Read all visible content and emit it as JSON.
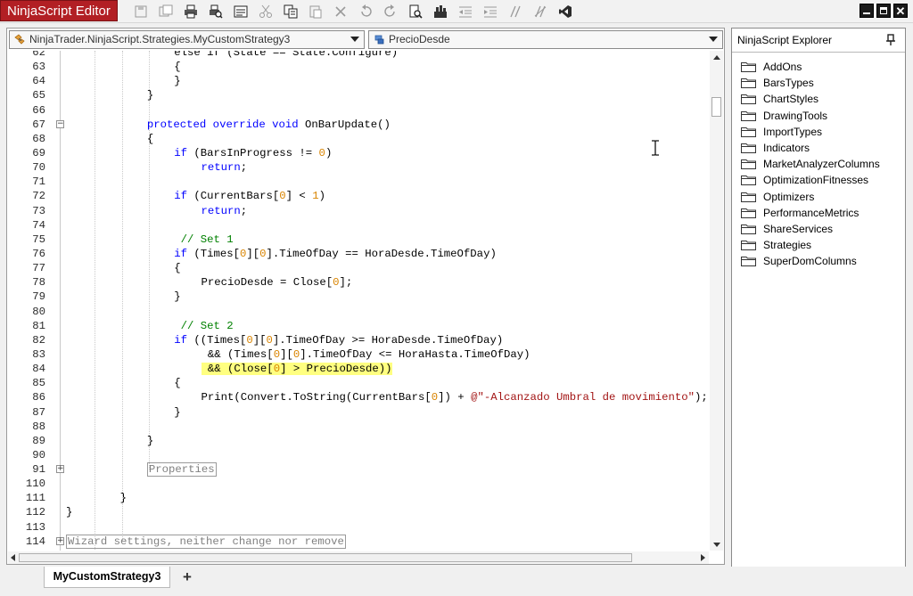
{
  "window": {
    "title": "NinjaScript Editor"
  },
  "toolbar": {
    "icons": [
      "save-icon",
      "save-all-icon",
      "print-icon",
      "print-preview-icon",
      "properties-icon",
      "cut-icon",
      "copy-icon",
      "paste-icon",
      "delete-icon",
      "undo-icon",
      "redo-icon",
      "find-icon",
      "compile-icon",
      "outdent-icon",
      "indent-icon",
      "comment-icon",
      "uncomment-icon",
      "visual-studio-icon"
    ]
  },
  "editor": {
    "class_dropdown": "NinjaTrader.NinjaScript.Strategies.MyCustomStrategy3",
    "member_dropdown": "PrecioDesde",
    "lines": [
      {
        "n": "62",
        "fold": "",
        "indent": 4,
        "seg": [
          {
            "t": "else if (State == State.Configure)",
            "c": ""
          }
        ]
      },
      {
        "n": "63",
        "fold": "",
        "indent": 4,
        "seg": [
          {
            "t": "{",
            "c": ""
          }
        ]
      },
      {
        "n": "64",
        "fold": "",
        "indent": 4,
        "seg": [
          {
            "t": "}",
            "c": ""
          }
        ]
      },
      {
        "n": "65",
        "fold": "",
        "indent": 3,
        "seg": [
          {
            "t": "}",
            "c": ""
          }
        ]
      },
      {
        "n": "66",
        "fold": "",
        "indent": 0,
        "seg": []
      },
      {
        "n": "67",
        "fold": "minus",
        "indent": 3,
        "seg": [
          {
            "t": "protected override void",
            "c": "kw"
          },
          {
            "t": " OnBarUpdate()",
            "c": ""
          }
        ]
      },
      {
        "n": "68",
        "fold": "",
        "indent": 3,
        "seg": [
          {
            "t": "{",
            "c": ""
          }
        ]
      },
      {
        "n": "69",
        "fold": "",
        "indent": 4,
        "seg": [
          {
            "t": "if",
            "c": "kw"
          },
          {
            "t": " (BarsInProgress != ",
            "c": ""
          },
          {
            "t": "0",
            "c": "num"
          },
          {
            "t": ")",
            "c": ""
          }
        ]
      },
      {
        "n": "70",
        "fold": "",
        "indent": 5,
        "seg": [
          {
            "t": "return",
            "c": "kw"
          },
          {
            "t": ";",
            "c": ""
          }
        ]
      },
      {
        "n": "71",
        "fold": "",
        "indent": 0,
        "seg": []
      },
      {
        "n": "72",
        "fold": "",
        "indent": 4,
        "seg": [
          {
            "t": "if",
            "c": "kw"
          },
          {
            "t": " (CurrentBars[",
            "c": ""
          },
          {
            "t": "0",
            "c": "num"
          },
          {
            "t": "] < ",
            "c": ""
          },
          {
            "t": "1",
            "c": "num"
          },
          {
            "t": ")",
            "c": ""
          }
        ]
      },
      {
        "n": "73",
        "fold": "",
        "indent": 5,
        "seg": [
          {
            "t": "return",
            "c": "kw"
          },
          {
            "t": ";",
            "c": ""
          }
        ]
      },
      {
        "n": "74",
        "fold": "",
        "indent": 0,
        "seg": []
      },
      {
        "n": "75",
        "fold": "",
        "indent": 4,
        "seg": [
          {
            "t": " // Set 1",
            "c": "cm"
          }
        ]
      },
      {
        "n": "76",
        "fold": "",
        "indent": 4,
        "seg": [
          {
            "t": "if",
            "c": "kw"
          },
          {
            "t": " (Times[",
            "c": ""
          },
          {
            "t": "0",
            "c": "num"
          },
          {
            "t": "][",
            "c": ""
          },
          {
            "t": "0",
            "c": "num"
          },
          {
            "t": "].TimeOfDay == HoraDesde.TimeOfDay)",
            "c": ""
          }
        ]
      },
      {
        "n": "77",
        "fold": "",
        "indent": 4,
        "seg": [
          {
            "t": "{",
            "c": ""
          }
        ]
      },
      {
        "n": "78",
        "fold": "",
        "indent": 5,
        "seg": [
          {
            "t": "PrecioDesde = Close[",
            "c": ""
          },
          {
            "t": "0",
            "c": "num"
          },
          {
            "t": "];",
            "c": ""
          }
        ]
      },
      {
        "n": "79",
        "fold": "",
        "indent": 4,
        "seg": [
          {
            "t": "}",
            "c": ""
          }
        ]
      },
      {
        "n": "80",
        "fold": "",
        "indent": 0,
        "seg": []
      },
      {
        "n": "81",
        "fold": "",
        "indent": 4,
        "seg": [
          {
            "t": " // Set 2",
            "c": "cm"
          }
        ]
      },
      {
        "n": "82",
        "fold": "",
        "indent": 4,
        "seg": [
          {
            "t": "if",
            "c": "kw"
          },
          {
            "t": " ((Times[",
            "c": ""
          },
          {
            "t": "0",
            "c": "num"
          },
          {
            "t": "][",
            "c": ""
          },
          {
            "t": "0",
            "c": "num"
          },
          {
            "t": "].TimeOfDay >= HoraDesde.TimeOfDay)",
            "c": ""
          }
        ]
      },
      {
        "n": "83",
        "fold": "",
        "indent": 5,
        "seg": [
          {
            "t": " && (Times[",
            "c": ""
          },
          {
            "t": "0",
            "c": "num"
          },
          {
            "t": "][",
            "c": ""
          },
          {
            "t": "0",
            "c": "num"
          },
          {
            "t": "].TimeOfDay <= HoraHasta.TimeOfDay)",
            "c": ""
          }
        ]
      },
      {
        "n": "84",
        "fold": "",
        "indent": 5,
        "seg": [
          {
            "t": " && (Close[",
            "c": "hl"
          },
          {
            "t": "0",
            "c": "hl num"
          },
          {
            "t": "] > PrecioDesde))",
            "c": "hl"
          }
        ]
      },
      {
        "n": "85",
        "fold": "",
        "indent": 4,
        "seg": [
          {
            "t": "{",
            "c": ""
          }
        ]
      },
      {
        "n": "86",
        "fold": "",
        "indent": 5,
        "seg": [
          {
            "t": "Print(Convert.ToString(CurrentBars[",
            "c": ""
          },
          {
            "t": "0",
            "c": "num"
          },
          {
            "t": "]) + ",
            "c": ""
          },
          {
            "t": "@\"-Alcanzado Umbral de movimiento\"",
            "c": "str"
          },
          {
            "t": ");",
            "c": ""
          }
        ]
      },
      {
        "n": "87",
        "fold": "",
        "indent": 4,
        "seg": [
          {
            "t": "}",
            "c": ""
          }
        ]
      },
      {
        "n": "88",
        "fold": "",
        "indent": 0,
        "seg": []
      },
      {
        "n": "89",
        "fold": "",
        "indent": 3,
        "seg": [
          {
            "t": "}",
            "c": ""
          }
        ]
      },
      {
        "n": "90",
        "fold": "",
        "indent": 0,
        "seg": []
      },
      {
        "n": "91",
        "fold": "plus",
        "indent": 3,
        "seg": [
          {
            "t": "Properties",
            "c": "boxed"
          }
        ]
      },
      {
        "n": "110",
        "fold": "",
        "indent": 0,
        "seg": []
      },
      {
        "n": "111",
        "fold": "",
        "indent": 2,
        "seg": [
          {
            "t": "}",
            "c": ""
          }
        ]
      },
      {
        "n": "112",
        "fold": "",
        "indent": 0,
        "seg": [
          {
            "t": "}",
            "c": ""
          }
        ]
      },
      {
        "n": "113",
        "fold": "",
        "indent": 0,
        "seg": []
      },
      {
        "n": "114",
        "fold": "plus",
        "indent": 0,
        "seg": [
          {
            "t": "Wizard settings, neither change nor remove",
            "c": "boxed"
          }
        ]
      }
    ]
  },
  "explorer": {
    "title": "NinjaScript Explorer",
    "folders": [
      "AddOns",
      "BarsTypes",
      "ChartStyles",
      "DrawingTools",
      "ImportTypes",
      "Indicators",
      "MarketAnalyzerColumns",
      "OptimizationFitnesses",
      "Optimizers",
      "PerformanceMetrics",
      "ShareServices",
      "Strategies",
      "SuperDomColumns"
    ]
  },
  "tabs": {
    "active": "MyCustomStrategy3",
    "add": "+"
  },
  "colors": {
    "title_bar": "#b21f24",
    "keyword": "#0000ff",
    "number": "#d98400",
    "comment": "#008000",
    "string": "#a31515",
    "highlight": "#ffff80"
  }
}
